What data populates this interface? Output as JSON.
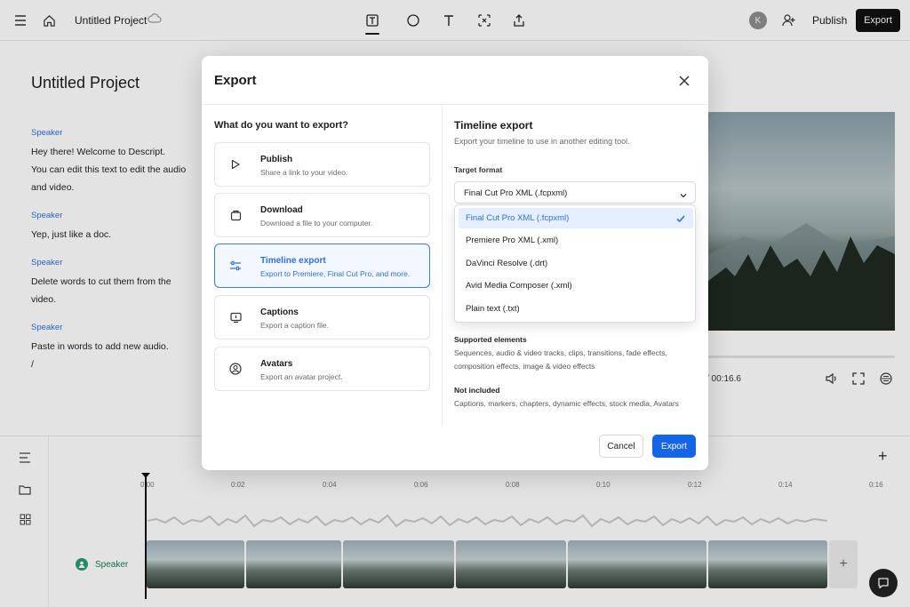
{
  "topbar": {
    "project_name": "Untitled Project",
    "avatar_initial": "K",
    "publish_label": "Publish",
    "export_label": "Export"
  },
  "document": {
    "title": "Untitled Project",
    "paragraphs": [
      {
        "speaker": "Speaker",
        "lines": [
          "Hey there! Welcome to Descript.",
          "You can edit this text to edit the audio",
          "and video."
        ]
      },
      {
        "speaker": "Speaker",
        "lines": [
          "Yep, just like a doc."
        ]
      },
      {
        "speaker": "Speaker",
        "lines": [
          "Delete words to cut them from the",
          "video."
        ]
      },
      {
        "speaker": "Speaker",
        "lines": [
          "Paste in words to add new audio.",
          "/"
        ]
      }
    ]
  },
  "player": {
    "time_text": "/ 00:16.6"
  },
  "timeline": {
    "ticks": [
      "0:00",
      "0:02",
      "0:04",
      "0:06",
      "0:08",
      "0:10",
      "0:12",
      "0:14",
      "0:16"
    ],
    "speaker_label": "Speaker",
    "add_label": "+"
  },
  "modal": {
    "title": "Export",
    "left_heading": "What do you want to export?",
    "options": [
      {
        "title": "Publish",
        "desc": "Share a link to your video."
      },
      {
        "title": "Download",
        "desc": "Download a file to your computer."
      },
      {
        "title": "Timeline export",
        "desc": "Export to Premiere, Final Cut Pro, and more."
      },
      {
        "title": "Captions",
        "desc": "Export a caption file."
      },
      {
        "title": "Avatars",
        "desc": "Export an avatar project."
      }
    ],
    "selected_option": "Timeline export",
    "right": {
      "title": "Timeline export",
      "subtitle": "Export your timeline to use in another editing tool.",
      "format_label": "Target format",
      "format_value": "Final Cut Pro XML (.fcpxml)",
      "format_options": [
        "Final Cut Pro XML (.fcpxml)",
        "Premiere Pro XML (.xml)",
        "DaVinci Resolve (.drt)",
        "Avid Media Composer (.xml)",
        "Plain text (.txt)"
      ],
      "supported_label": "Supported elements",
      "supported_text": "Sequences, audio & video tracks, clips, transitions, fade effects, composition effects, image & video effects",
      "not_included_label": "Not included",
      "not_included_text": "Captions, markers, chapters, dynamic effects, stock media, Avatars"
    },
    "cancel_label": "Cancel",
    "export_label": "Export"
  },
  "colors": {
    "accent": "#1465e8",
    "selected_bg": "#f3f8ff",
    "speaker_blue": "#2e6fdc"
  }
}
